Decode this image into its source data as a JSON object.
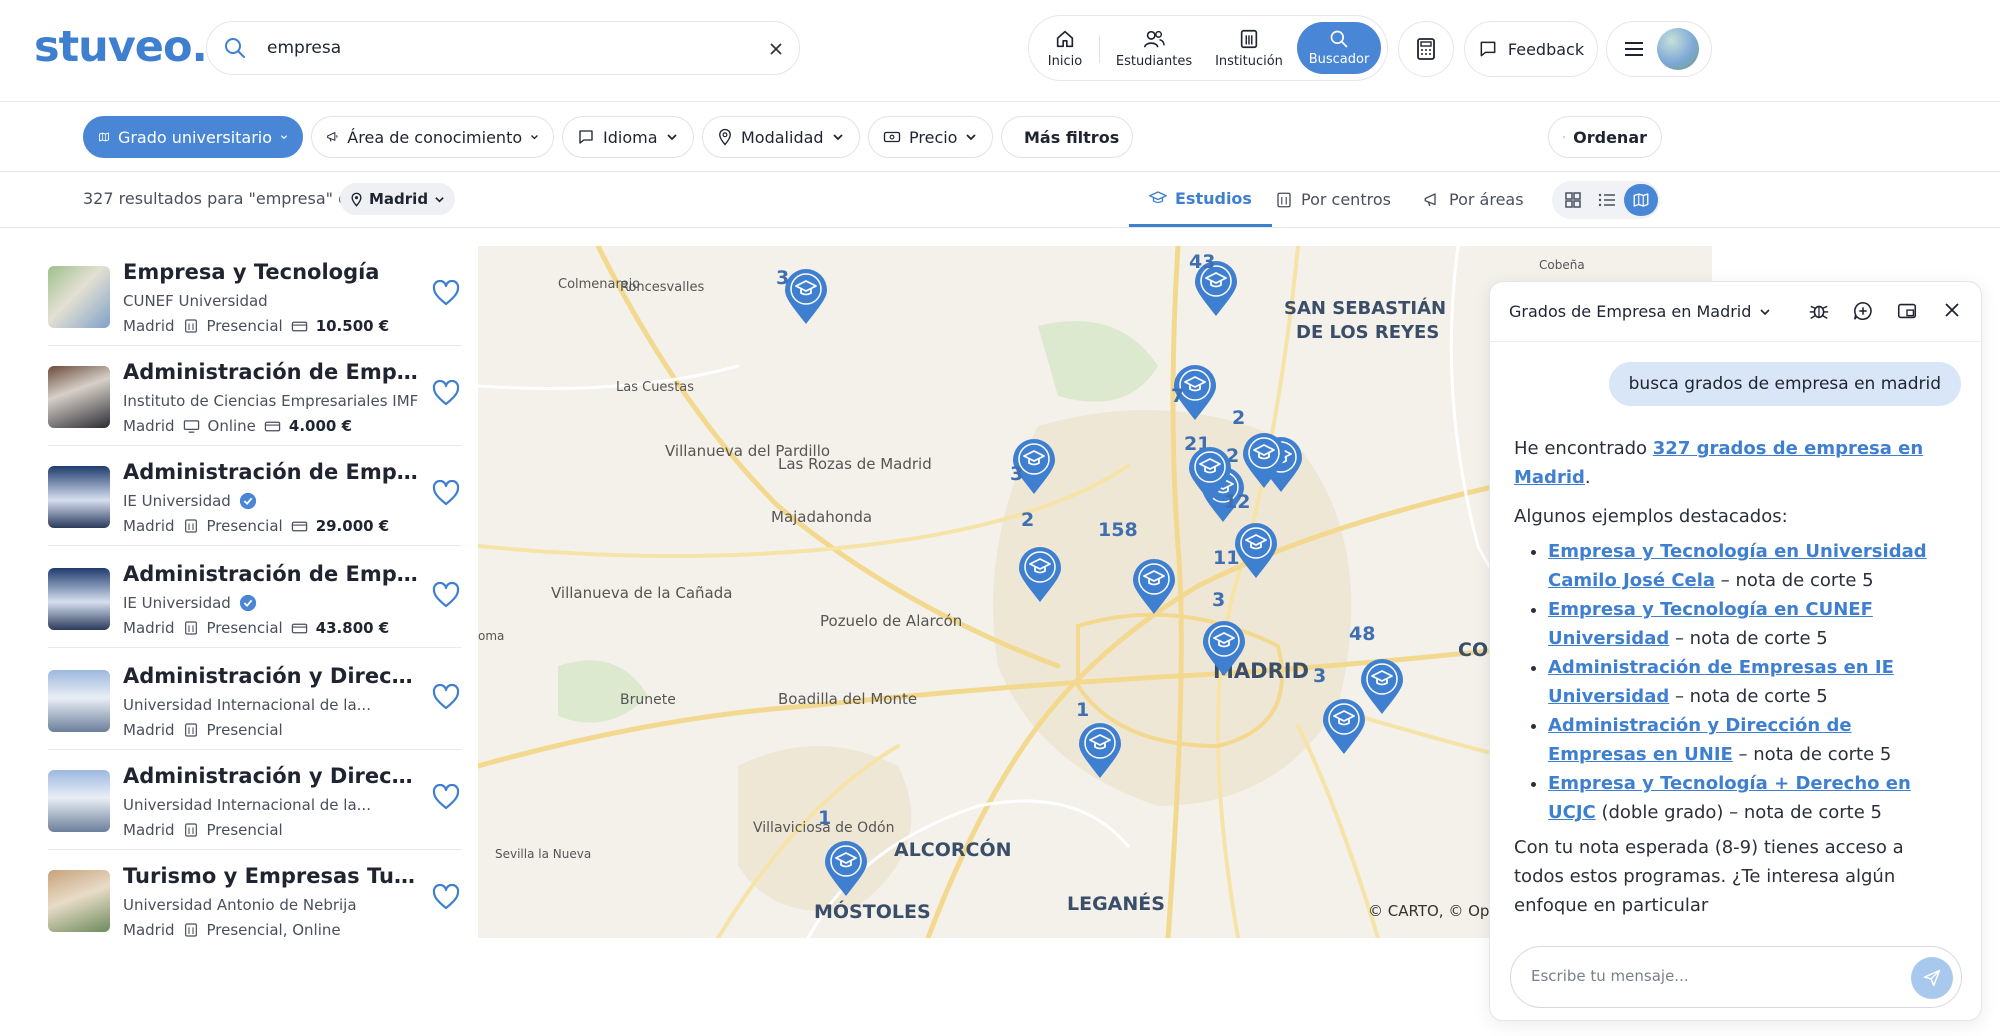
{
  "brand": {
    "logo": "stuveo."
  },
  "search": {
    "value": "empresa"
  },
  "nav": {
    "items": [
      {
        "label": "Inicio",
        "icon": "home-icon"
      },
      {
        "label": "Estudiantes",
        "icon": "users-icon"
      },
      {
        "label": "Institución",
        "icon": "institution-icon"
      }
    ],
    "active": {
      "label": "Buscador",
      "icon": "search-icon"
    }
  },
  "header": {
    "feedback_label": "Feedback"
  },
  "filters": {
    "degree": "Grado universitario",
    "area": "Área de conocimiento",
    "language": "Idioma",
    "mode": "Modalidad",
    "price": "Precio",
    "more": "Más filtros",
    "sort": "Ordenar"
  },
  "results": {
    "count_text": "327 resultados para \"empresa\" en",
    "location": "Madrid"
  },
  "tabs": [
    {
      "label": "Estudios",
      "icon": "graduation-cap-icon",
      "selected": true
    },
    {
      "label": "Por centros",
      "icon": "building-icon",
      "selected": false
    },
    {
      "label": "Por áreas",
      "icon": "megaphone-icon",
      "selected": false
    }
  ],
  "list": [
    {
      "title": "Empresa y Tecnología",
      "institution": "CUNEF Universidad",
      "verified": false,
      "city": "Madrid",
      "mode": "Presencial",
      "mode_icon": "building-icon",
      "price": "10.500 €"
    },
    {
      "title": "Administración de Empresas",
      "institution": "Instituto de Ciencias Empresariales IMF",
      "verified": false,
      "city": "Madrid",
      "mode": "Online",
      "mode_icon": "monitor-icon",
      "price": "4.000 €"
    },
    {
      "title": "Administración de Empresas",
      "institution": "IE Universidad",
      "verified": true,
      "city": "Madrid",
      "mode": "Presencial",
      "mode_icon": "building-icon",
      "price": "29.000 €"
    },
    {
      "title": "Administración de Empresas",
      "institution": "IE Universidad",
      "verified": true,
      "city": "Madrid",
      "mode": "Presencial",
      "mode_icon": "building-icon",
      "price": "43.800 €"
    },
    {
      "title": "Administración y Dirección de...",
      "institution": "Universidad Internacional de la...",
      "verified": false,
      "city": "Madrid",
      "mode": "Presencial",
      "mode_icon": "building-icon",
      "price": ""
    },
    {
      "title": "Administración y Dirección de...",
      "institution": "Universidad Internacional de la...",
      "verified": false,
      "city": "Madrid",
      "mode": "Presencial",
      "mode_icon": "building-icon",
      "price": ""
    },
    {
      "title": "Turismo y Empresas Turísticas",
      "institution": "Universidad Antonio de Nebrija",
      "verified": false,
      "city": "Madrid",
      "mode": "Presencial, Online",
      "mode_icon": "building-icon",
      "price": ""
    }
  ],
  "map": {
    "places": [
      "Colmenarejo",
      "Roncesvalles",
      "Las Cuestas",
      "Villanueva del Pardillo",
      "Las Rozas de Madrid",
      "Majadahonda",
      "Villanueva de la Cañada",
      "Pozuelo de Alarcón",
      "Boadilla del Monte",
      "Brunete",
      "Villaviciosa de Odón",
      "Sevilla la Nueva",
      "ALCORCÓN",
      "MÓSTOLES",
      "LEGANÉS",
      "MADRID",
      "SAN SEBASTIÁN",
      "DE LOS REYES",
      "Cobeña",
      "COS",
      "oma"
    ],
    "cluster_counts": [
      "3",
      "43",
      "7",
      "2",
      "21",
      "2",
      "3",
      "2",
      "158",
      "12",
      "11",
      "3",
      "48",
      "3",
      "1",
      "1"
    ],
    "attribution": "© CARTO, © Ope"
  },
  "chat": {
    "title": "Grados de Empresa en Madrid",
    "user_message": "busca grados de empresa en madrid",
    "intro_before": "He encontrado ",
    "intro_link": "327 grados de empresa en Madrid",
    "intro_after": ".",
    "examples_heading": "Algunos ejemplos destacados:",
    "examples": [
      {
        "link": "Empresa y Tecnología en Universidad Camilo José Cela",
        "rest": " – nota de corte 5"
      },
      {
        "link": "Empresa y Tecnología en CUNEF Universidad",
        "rest": " – nota de corte 5"
      },
      {
        "link": "Administración de Empresas en IE Universidad",
        "rest": " – nota de corte 5"
      },
      {
        "link": "Administración y Dirección de Empresas en UNIE",
        "rest": " – nota de corte 5"
      },
      {
        "link": "Empresa y Tecnología + Derecho en UCJC",
        "rest": " (doble grado) – nota de corte 5"
      }
    ],
    "closing": "Con tu nota esperada (8-9) tienes acceso a todos estos programas. ¿Te interesa algún enfoque en particular",
    "input_placeholder": "Escribe tu mensaje..."
  },
  "colors": {
    "accent": "#4a86d6",
    "brand": "#3f7fd0",
    "marker": "#3f7fd0"
  }
}
